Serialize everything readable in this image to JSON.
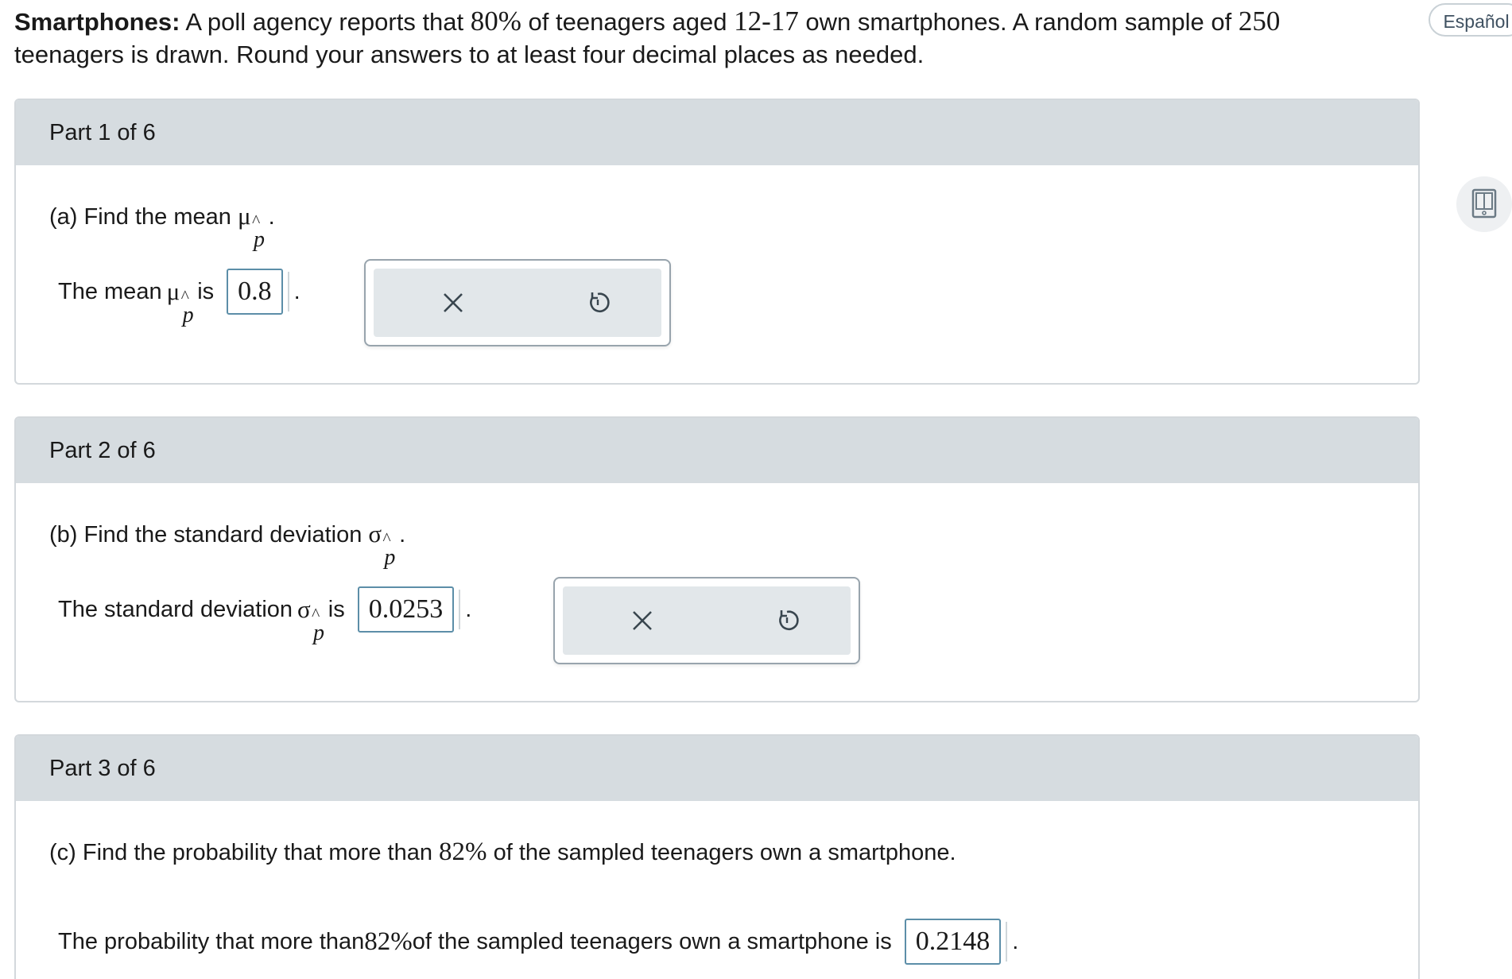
{
  "problem": {
    "bold_label": "Smartphones:",
    "seg1": " A poll agency reports that ",
    "pct": "80%",
    "seg2": " of teenagers aged ",
    "ages": "12-17",
    "seg3": " own smartphones. A random sample of ",
    "sample": "250",
    "seg4": "teenagers is drawn. Round your answers to at least four decimal places as needed."
  },
  "language_button": "Español",
  "side_tool_icon": "calculator-book-icon",
  "parts": [
    {
      "header": "Part 1 of 6",
      "question_prefix": "(a) Find the mean ",
      "question_symbol": "μ",
      "question_suffix": ".",
      "answer_prefix": "The mean ",
      "answer_symbol": "μ",
      "answer_mid": " is",
      "answer_value": "0.8",
      "answer_suffix": ".",
      "clear_icon": "close-icon",
      "undo_icon": "undo-icon"
    },
    {
      "header": "Part 2 of 6",
      "question_prefix": "(b) Find the standard deviation ",
      "question_symbol": "σ",
      "question_suffix": ".",
      "answer_prefix": "The standard deviation ",
      "answer_symbol": "σ",
      "answer_mid": " is",
      "answer_value": "0.0253",
      "answer_suffix": ".",
      "clear_icon": "close-icon",
      "undo_icon": "undo-icon"
    },
    {
      "header": "Part 3 of 6",
      "question_a": "(c) Find the probability that more than ",
      "question_pct": "82%",
      "question_b": " of the sampled teenagers own a smartphone.",
      "answer_a": "The probability that more than ",
      "answer_pct": "82%",
      "answer_b": " of the sampled teenagers own a smartphone is",
      "answer_value": "0.2148",
      "answer_suffix": "."
    }
  ],
  "hat_symbol": "^",
  "sub_p": "p"
}
